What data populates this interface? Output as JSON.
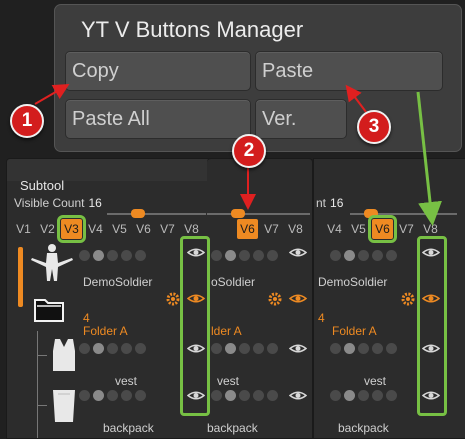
{
  "manager": {
    "title": "YT V Buttons Manager",
    "buttons": {
      "copy": "Copy",
      "paste": "Paste",
      "paste_all": "Paste All",
      "ver": "Ver."
    }
  },
  "subtool": {
    "header": "Subtool",
    "visible_count_label": "Visible Count",
    "visible_count_value": "16",
    "versions": [
      "V1",
      "V2",
      "V3",
      "V4",
      "V5",
      "V6",
      "V7",
      "V8"
    ],
    "rows": {
      "demosoldier": "DemoSoldier",
      "folder_count": "4",
      "folder": "Folder A",
      "vest": "vest",
      "backpack": "backpack"
    }
  },
  "panel2": {
    "active_version": "V6",
    "partial_demosoldier": "oSoldier",
    "partial_folder": "lder A"
  },
  "panel3": {
    "partial_visible_label": "nt",
    "active_version": "V6"
  },
  "callouts": {
    "one": "1",
    "two": "2",
    "three": "3"
  },
  "colors": {
    "accent": "#ee8a22",
    "highlight_green": "#77c044",
    "callout_red": "#d31d1d"
  },
  "active_versions": {
    "panel1": "V3",
    "panel2": "V6",
    "panel3": "V6"
  }
}
